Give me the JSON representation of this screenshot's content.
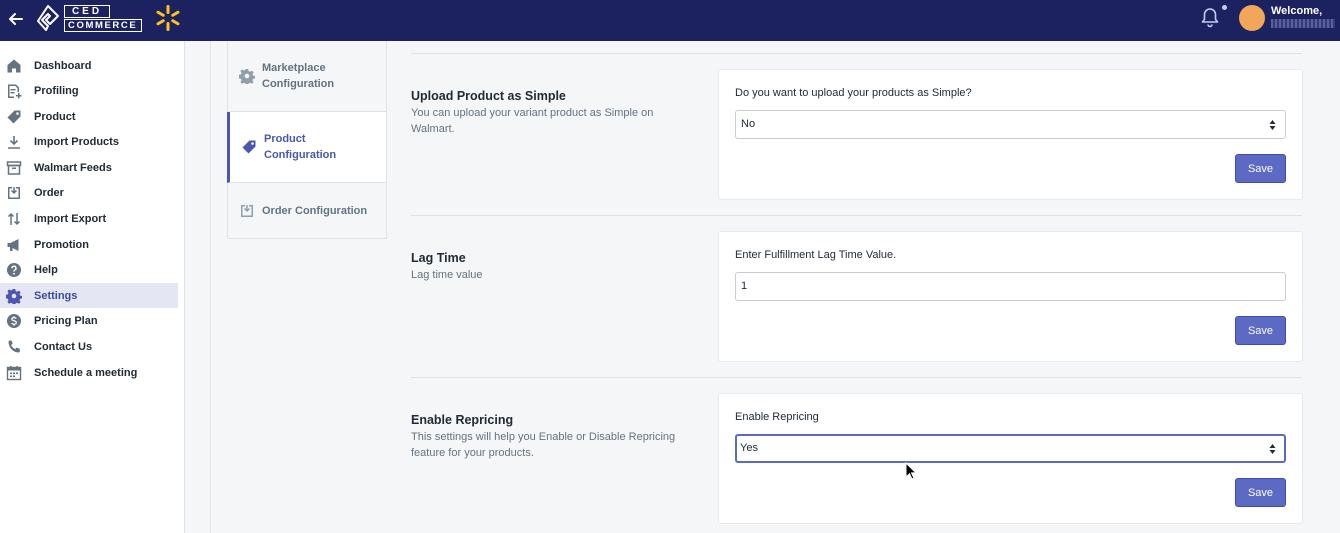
{
  "header": {
    "logo_line1": "CED",
    "logo_line2": "COMMERCE",
    "welcome": "Welcome,"
  },
  "sidebar": {
    "items": [
      {
        "label": "Dashboard",
        "icon": "home-icon"
      },
      {
        "label": "Profiling",
        "icon": "profile-icon"
      },
      {
        "label": "Product",
        "icon": "tag-icon"
      },
      {
        "label": "Import Products",
        "icon": "download-icon"
      },
      {
        "label": "Walmart Feeds",
        "icon": "archive-icon"
      },
      {
        "label": "Order",
        "icon": "inbox-icon"
      },
      {
        "label": "Import Export",
        "icon": "swap-icon"
      },
      {
        "label": "Promotion",
        "icon": "megaphone-icon"
      },
      {
        "label": "Help",
        "icon": "help-icon"
      },
      {
        "label": "Settings",
        "icon": "gear-icon",
        "active": true
      },
      {
        "label": "Pricing Plan",
        "icon": "dollar-icon"
      },
      {
        "label": "Contact Us",
        "icon": "phone-icon"
      },
      {
        "label": "Schedule a meeting",
        "icon": "calendar-icon"
      }
    ]
  },
  "tabs": [
    {
      "label": "Marketplace Configuration",
      "icon": "gear-icon"
    },
    {
      "label": "Product Configuration",
      "icon": "tag-icon",
      "active": true
    },
    {
      "label": "Order Configuration",
      "icon": "inbox-icon"
    }
  ],
  "sections": [
    {
      "title": "Upload Product as Simple",
      "description": "You can upload your variant product as Simple on Walmart.",
      "field_label": "Do you want to upload your products as Simple?",
      "field_type": "select",
      "value": "No",
      "save_label": "Save"
    },
    {
      "title": "Lag Time",
      "description": "Lag time value",
      "field_label": "Enter Fulfillment Lag Time Value.",
      "field_type": "text",
      "value": "1",
      "save_label": "Save"
    },
    {
      "title": "Enable Repricing",
      "description": "This settings will help you Enable or Disable Repricing feature for your products.",
      "field_label": "Enable Repricing",
      "field_type": "select",
      "value": "Yes",
      "save_label": "Save"
    }
  ],
  "colors": {
    "topbar": "#1c2260",
    "accent": "#5c6ac4",
    "walmart_yellow": "#ffc220",
    "avatar": "#f2a65a"
  }
}
